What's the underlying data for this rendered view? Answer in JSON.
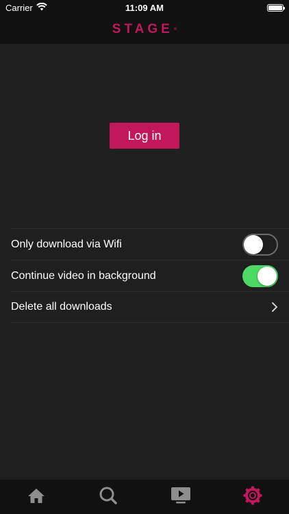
{
  "status_bar": {
    "carrier": "Carrier",
    "time": "11:09 AM",
    "wifi_icon": "wifi-icon",
    "battery_icon": "battery-icon"
  },
  "header": {
    "logo_text": "STAGE",
    "logo_mark": "®",
    "brand_color": "#c2185b"
  },
  "login": {
    "button_label": "Log in"
  },
  "settings": {
    "items": [
      {
        "label": "Only download via Wifi",
        "control": "toggle",
        "on": false
      },
      {
        "label": "Continue video in background",
        "control": "toggle",
        "on": true
      },
      {
        "label": "Delete all downloads",
        "control": "chevron"
      }
    ]
  },
  "tab_bar": {
    "tabs": [
      {
        "icon": "home-icon",
        "active": false
      },
      {
        "icon": "search-icon",
        "active": false
      },
      {
        "icon": "play-video-icon",
        "active": false
      },
      {
        "icon": "gear-icon",
        "active": true
      }
    ],
    "active_color": "#c2185b",
    "inactive_color": "#8e8e8e"
  },
  "colors": {
    "background": "#1f1f1f",
    "toggle_on": "#4cd964"
  }
}
